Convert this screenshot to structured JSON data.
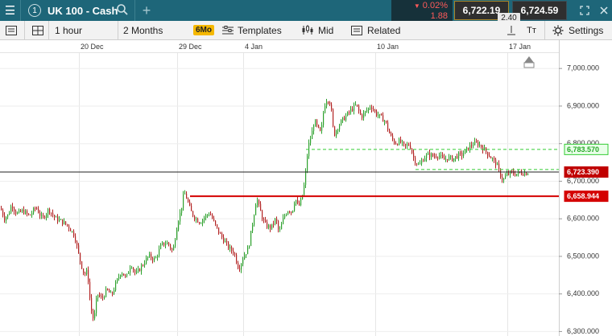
{
  "header": {
    "tab_number": "1",
    "instrument": "UK 100 - Cash",
    "change_percent": "0.02%",
    "change_points": "1.88",
    "sell_price": "6,722.19",
    "buy_price": "6,724.59",
    "spread": "2.40"
  },
  "toolbar": {
    "interval": "1 hour",
    "range": "2 Months",
    "range_badge": "6Mo",
    "templates": "Templates",
    "price_type": "Mid",
    "related": "Related",
    "settings": "Settings"
  },
  "colors": {
    "header_bg": "#1e6679",
    "bull": "#2ca02c",
    "bear": "#b22222",
    "support_line": "#d40000",
    "resistance_line": "#33cc33",
    "current_price_tag": "#c00000"
  },
  "chart_data": {
    "type": "candlestick",
    "y_ticks": [
      "7,000.000",
      "6,900.000",
      "6,800.000",
      "6,700.000",
      "6,600.000",
      "6,500.000",
      "6,400.000",
      "6,300.000"
    ],
    "y_tick_values": [
      7000,
      6900,
      6800,
      6700,
      6600,
      6500,
      6400,
      6300
    ],
    "x_ticks": [
      "20 Dec",
      "29 Dec",
      "4 Jan",
      "10 Jan",
      "17 Jan"
    ],
    "ylim": [
      6287,
      7040
    ],
    "grid": true,
    "levels": [
      {
        "label": "6,783.570",
        "value": 6783.57,
        "style": "dashed",
        "color": "#33cc33"
      },
      {
        "label": "6,723.390",
        "value": 6723.39,
        "style": "solid",
        "color": "#000000",
        "current": true
      },
      {
        "label": "6,658.944",
        "value": 6658.944,
        "style": "solid",
        "color": "#d40000"
      }
    ],
    "path": [
      [
        0,
        6628
      ],
      [
        5,
        6600
      ],
      [
        10,
        6610
      ],
      [
        14,
        6638
      ],
      [
        20,
        6612
      ],
      [
        28,
        6620
      ],
      [
        36,
        6606
      ],
      [
        44,
        6630
      ],
      [
        52,
        6598
      ],
      [
        60,
        6625
      ],
      [
        68,
        6600
      ],
      [
        76,
        6592
      ],
      [
        84,
        6580
      ],
      [
        92,
        6555
      ],
      [
        98,
        6495
      ],
      [
        104,
        6450
      ],
      [
        108,
        6460
      ],
      [
        112,
        6365
      ],
      [
        116,
        6325
      ],
      [
        120,
        6400
      ],
      [
        126,
        6385
      ],
      [
        132,
        6410
      ],
      [
        138,
        6395
      ],
      [
        144,
        6430
      ],
      [
        150,
        6460
      ],
      [
        156,
        6440
      ],
      [
        162,
        6480
      ],
      [
        168,
        6450
      ],
      [
        176,
        6475
      ],
      [
        184,
        6500
      ],
      [
        192,
        6490
      ],
      [
        200,
        6530
      ],
      [
        208,
        6535
      ],
      [
        214,
        6510
      ],
      [
        220,
        6590
      ],
      [
        224,
        6620
      ],
      [
        228,
        6670
      ],
      [
        232,
        6650
      ],
      [
        236,
        6620
      ],
      [
        242,
        6600
      ],
      [
        248,
        6590
      ],
      [
        254,
        6605
      ],
      [
        260,
        6615
      ],
      [
        266,
        6585
      ],
      [
        272,
        6560
      ],
      [
        278,
        6540
      ],
      [
        284,
        6520
      ],
      [
        290,
        6510
      ],
      [
        296,
        6465
      ],
      [
        302,
        6500
      ],
      [
        308,
        6520
      ],
      [
        314,
        6600
      ],
      [
        318,
        6655
      ],
      [
        322,
        6625
      ],
      [
        326,
        6595
      ],
      [
        330,
        6580
      ],
      [
        336,
        6575
      ],
      [
        342,
        6600
      ],
      [
        346,
        6560
      ],
      [
        352,
        6605
      ],
      [
        358,
        6625
      ],
      [
        362,
        6615
      ],
      [
        366,
        6655
      ],
      [
        370,
        6630
      ],
      [
        374,
        6650
      ],
      [
        378,
        6700
      ],
      [
        382,
        6790
      ],
      [
        386,
        6820
      ],
      [
        390,
        6860
      ],
      [
        394,
        6840
      ],
      [
        398,
        6825
      ],
      [
        402,
        6900
      ],
      [
        406,
        6920
      ],
      [
        410,
        6905
      ],
      [
        414,
        6820
      ],
      [
        418,
        6840
      ],
      [
        424,
        6860
      ],
      [
        430,
        6875
      ],
      [
        436,
        6890
      ],
      [
        442,
        6902
      ],
      [
        448,
        6870
      ],
      [
        454,
        6885
      ],
      [
        460,
        6900
      ],
      [
        466,
        6880
      ],
      [
        472,
        6870
      ],
      [
        478,
        6858
      ],
      [
        484,
        6820
      ],
      [
        490,
        6800
      ],
      [
        496,
        6805
      ],
      [
        502,
        6790
      ],
      [
        508,
        6798
      ],
      [
        514,
        6755
      ],
      [
        520,
        6740
      ],
      [
        526,
        6762
      ],
      [
        532,
        6770
      ],
      [
        538,
        6765
      ],
      [
        544,
        6770
      ],
      [
        550,
        6755
      ],
      [
        556,
        6762
      ],
      [
        562,
        6758
      ],
      [
        568,
        6768
      ],
      [
        574,
        6770
      ],
      [
        580,
        6785
      ],
      [
        586,
        6798
      ],
      [
        592,
        6800
      ],
      [
        598,
        6790
      ],
      [
        604,
        6775
      ],
      [
        610,
        6760
      ],
      [
        616,
        6745
      ],
      [
        620,
        6720
      ],
      [
        624,
        6700
      ],
      [
        628,
        6715
      ],
      [
        634,
        6722
      ],
      [
        640,
        6718
      ],
      [
        646,
        6722
      ],
      [
        652,
        6720
      ],
      [
        656,
        6723
      ]
    ]
  }
}
